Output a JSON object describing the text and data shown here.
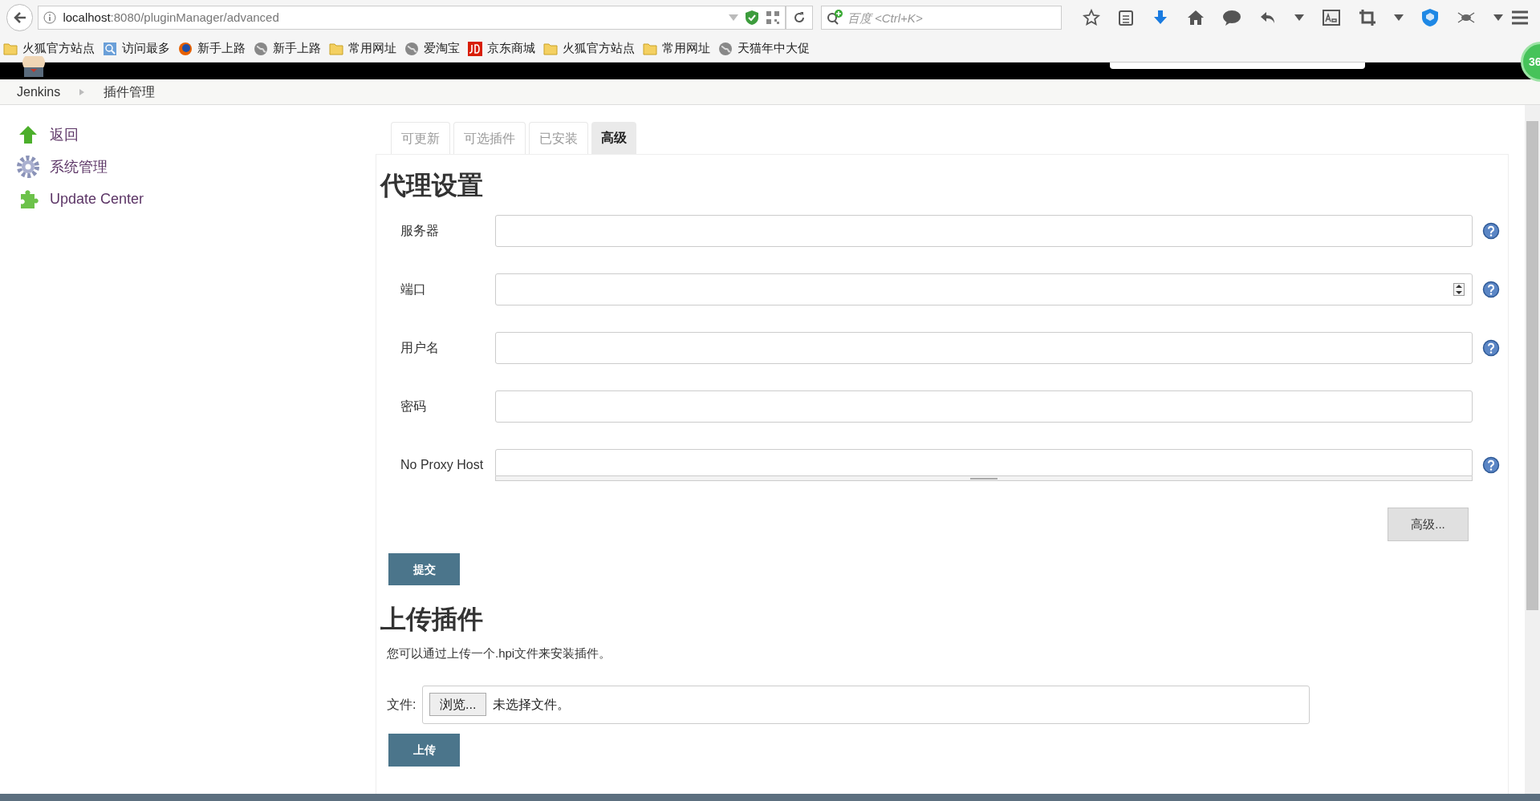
{
  "browser": {
    "url_host": "localhost",
    "url_rest": ":8080/pluginManager/advanced",
    "search_placeholder": "百度 <Ctrl+K>",
    "badge": "36"
  },
  "bookmarks": [
    {
      "label": "火狐官方站点",
      "kind": "folder"
    },
    {
      "label": "访问最多",
      "kind": "smart"
    },
    {
      "label": "新手上路",
      "kind": "firefox"
    },
    {
      "label": "新手上路",
      "kind": "globe"
    },
    {
      "label": "常用网址",
      "kind": "folder"
    },
    {
      "label": "爱淘宝",
      "kind": "globe"
    },
    {
      "label": "京东商城",
      "kind": "jd"
    },
    {
      "label": "火狐官方站点",
      "kind": "folder"
    },
    {
      "label": "常用网址",
      "kind": "folder"
    },
    {
      "label": "天猫年中大促",
      "kind": "globe"
    }
  ],
  "breadcrumbs": [
    "Jenkins",
    "插件管理"
  ],
  "sidebar": {
    "items": [
      {
        "label": "返回",
        "kind": "up"
      },
      {
        "label": "系统管理",
        "kind": "gear"
      },
      {
        "label": "Update Center",
        "kind": "puzzle"
      }
    ]
  },
  "tabs": [
    {
      "label": "可更新",
      "selected": false
    },
    {
      "label": "可选插件",
      "selected": false
    },
    {
      "label": "已安装",
      "selected": false
    },
    {
      "label": "高级",
      "selected": true
    }
  ],
  "proxy": {
    "heading": "代理设置",
    "fields": [
      {
        "label": "服务器",
        "kind": "text",
        "help": true
      },
      {
        "label": "端口",
        "kind": "number",
        "help": true
      },
      {
        "label": "用户名",
        "kind": "text",
        "help": true
      },
      {
        "label": "密码",
        "kind": "password",
        "help": false
      },
      {
        "label": "No Proxy Host",
        "kind": "textarea",
        "help": true
      }
    ],
    "advanced_button": "高级...",
    "submit_button": "提交"
  },
  "upload": {
    "heading": "上传插件",
    "description": "您可以通过上传一个.hpi文件来安装插件。",
    "file_label": "文件:",
    "browse_button": "浏览...",
    "file_status": "未选择文件。",
    "upload_button": "上传"
  }
}
